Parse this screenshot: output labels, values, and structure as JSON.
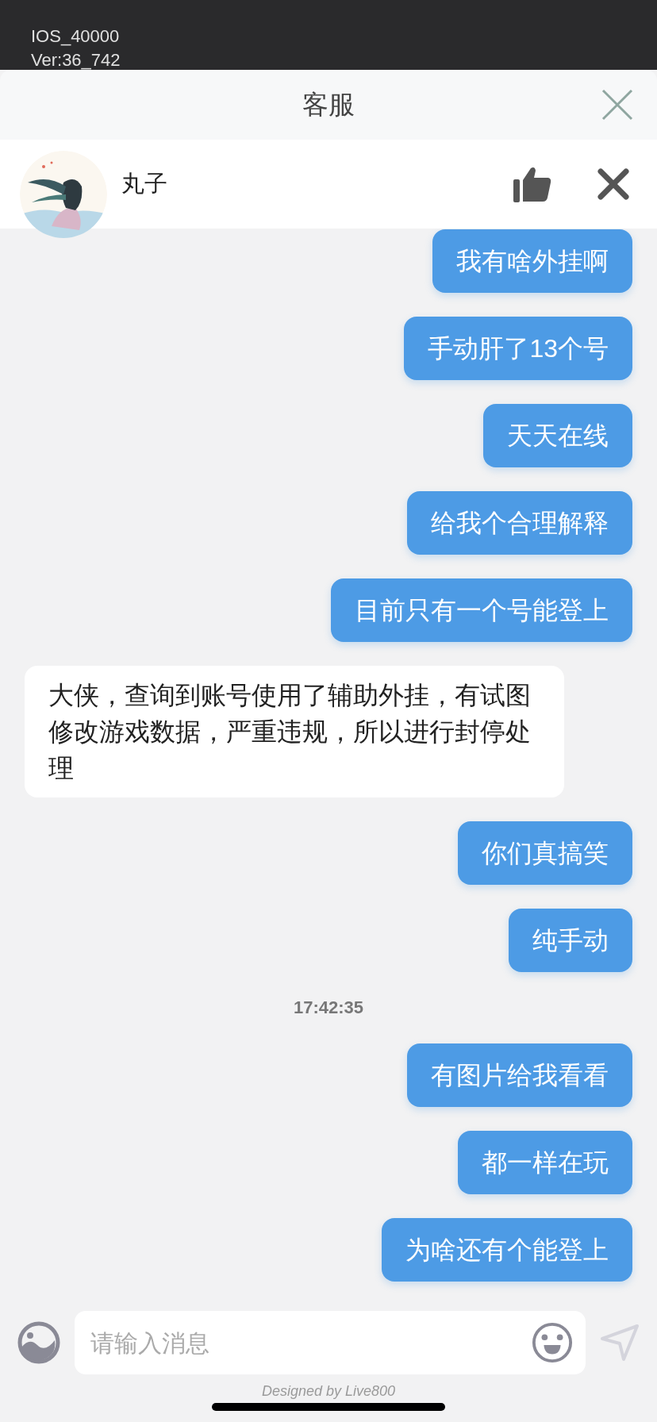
{
  "game_info": [
    "IOS_40000",
    "Ver:36_742"
  ],
  "dialog": {
    "title": "客服"
  },
  "agent": {
    "name": "丸子"
  },
  "messages": [
    {
      "kind": "user",
      "text": "我有啥外挂啊"
    },
    {
      "kind": "user",
      "text": "手动肝了13个号"
    },
    {
      "kind": "user",
      "text": "天天在线"
    },
    {
      "kind": "user",
      "text": "给我个合理解释"
    },
    {
      "kind": "user",
      "text": "目前只有一个号能登上"
    },
    {
      "kind": "agent",
      "text": "大侠，查询到账号使用了辅助外挂，有试图修改游戏数据，严重违规，所以进行封停处理"
    },
    {
      "kind": "user",
      "text": "你们真搞笑"
    },
    {
      "kind": "user",
      "text": "纯手动"
    },
    {
      "kind": "time",
      "text": "17:42:35"
    },
    {
      "kind": "user",
      "text": "有图片给我看看"
    },
    {
      "kind": "user",
      "text": "都一样在玩"
    },
    {
      "kind": "user",
      "text": "为啥还有个能登上"
    }
  ],
  "input": {
    "placeholder": "请输入消息"
  },
  "footer": "Designed by Live800"
}
